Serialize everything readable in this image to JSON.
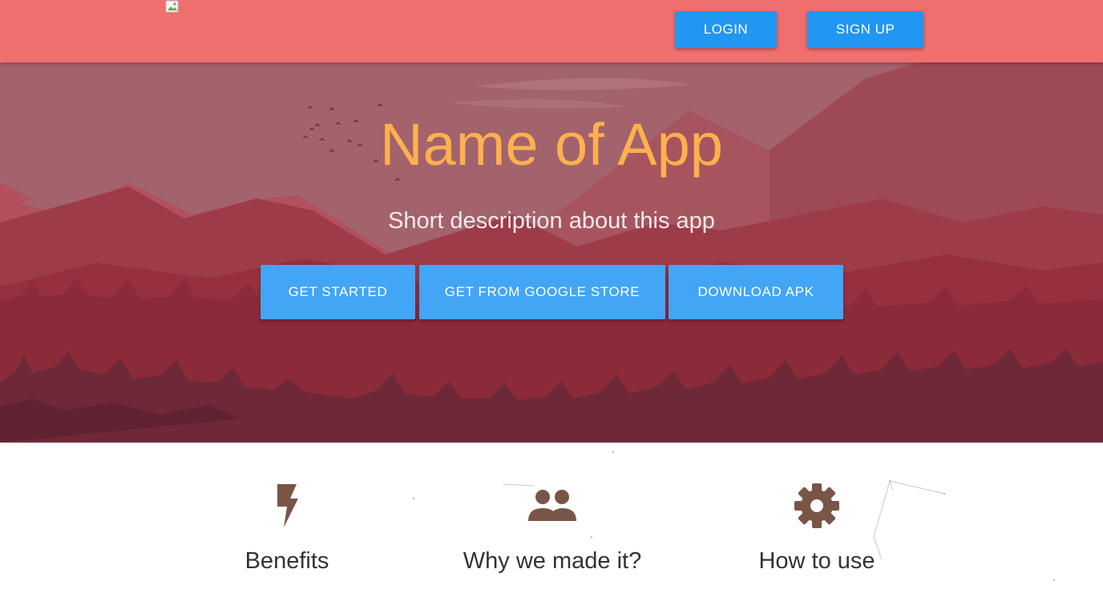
{
  "header": {
    "login_label": "LOGIN",
    "signup_label": "SIGN UP",
    "background": "#ef6e6e",
    "button_color": "#2196f3"
  },
  "hero": {
    "title": "Name of App",
    "description": "Short description about this app",
    "title_color": "#ffb04f",
    "buttons": [
      {
        "label": "GET STARTED"
      },
      {
        "label": "GET FROM GOOGLE STORE"
      },
      {
        "label": "DOWNLOAD APK"
      }
    ],
    "button_color": "#42a5f5"
  },
  "features": [
    {
      "icon": "lightning-bolt-icon",
      "label": "Benefits"
    },
    {
      "icon": "people-icon",
      "label": "Why we made it?"
    },
    {
      "icon": "gear-icon",
      "label": "How to use"
    }
  ],
  "icon_color": "#795548"
}
